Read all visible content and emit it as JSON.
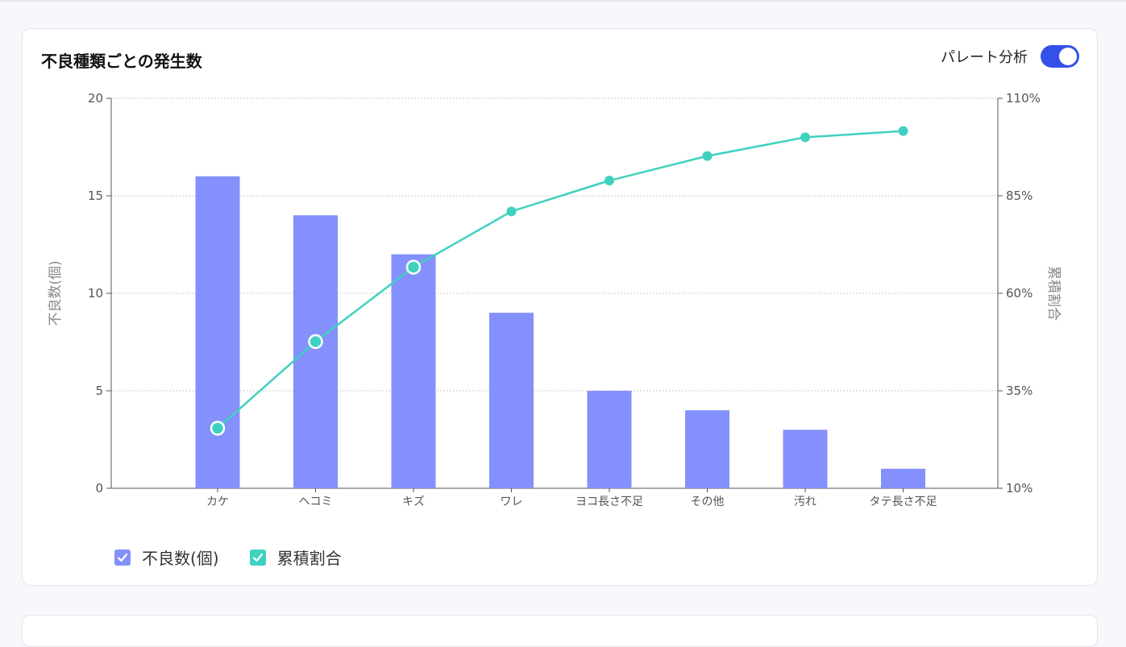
{
  "card": {
    "title": "不良種類ごとの発生数",
    "toggle_label": "パレート分析",
    "toggle_on": true
  },
  "colors": {
    "bar": "#8490fb",
    "line": "#3fd1c0",
    "toggle": "#3550e8",
    "grid": "#c8c8c8",
    "axis": "#555555",
    "tick_text": "#555555",
    "axis_title": "#888888"
  },
  "legend": [
    {
      "label": "不良数(個)",
      "color": "#8490fb",
      "checked": true
    },
    {
      "label": "累積割合",
      "color": "#3fd1c0",
      "checked": true
    }
  ],
  "chart_data": {
    "type": "bar",
    "categories": [
      "カケ",
      "ヘコミ",
      "キズ",
      "ワレ",
      "ヨコ長さ不足",
      "その他",
      "汚れ",
      "タテ長さ不足"
    ],
    "series": [
      {
        "name": "不良数(個)",
        "type": "bar",
        "axis": "left",
        "values": [
          16,
          14,
          12,
          9,
          5,
          4,
          3,
          1
        ]
      },
      {
        "name": "累積割合",
        "type": "line",
        "axis": "right",
        "values": [
          25.4,
          47.6,
          66.7,
          81.0,
          88.9,
          95.2,
          100.0,
          101.6
        ]
      }
    ],
    "ylabel": "不良数(個)",
    "y2label": "累積割合",
    "ylim": [
      0,
      20
    ],
    "y2lim": [
      10,
      110
    ],
    "yticks": [
      "0",
      "5",
      "10",
      "15",
      "20"
    ],
    "y2ticks": [
      "10%",
      "35%",
      "60%",
      "85%",
      "110%"
    ],
    "highlighted_points": [
      0,
      1,
      2
    ],
    "grid": true,
    "legend_position": "bottom-left"
  }
}
